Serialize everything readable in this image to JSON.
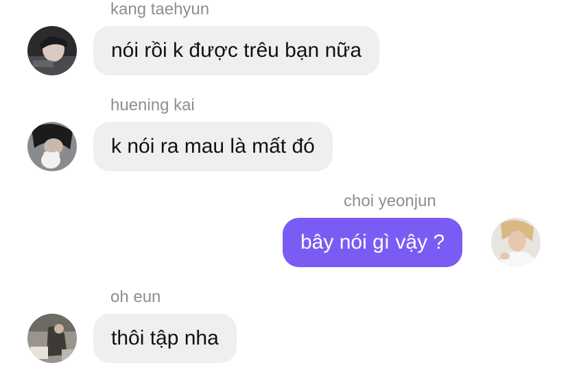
{
  "messages": [
    {
      "sender": "kang taehyun",
      "text": "nói rồi k được trêu bạn nữa",
      "direction": "incoming",
      "avatar_icon": "user-avatar-icon"
    },
    {
      "sender": "huening kai",
      "text": "k nói ra mau là mất đó",
      "direction": "incoming",
      "avatar_icon": "user-avatar-icon"
    },
    {
      "sender": "choi yeonjun",
      "text": "bây nói gì vậy ?",
      "direction": "outgoing",
      "avatar_icon": "user-avatar-icon"
    },
    {
      "sender": "oh eun",
      "text": "thôi tập nha",
      "direction": "incoming",
      "avatar_icon": "user-avatar-icon"
    }
  ],
  "colors": {
    "incoming_bubble": "#efeff0",
    "outgoing_bubble": "#7a5cf5",
    "sender_name": "#8e8e93"
  }
}
